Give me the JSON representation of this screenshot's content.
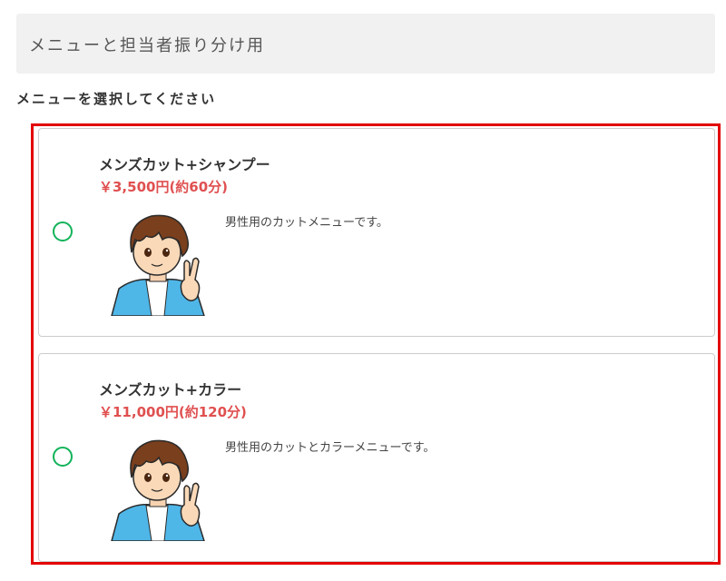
{
  "header": {
    "title": "メニューと担当者振り分け用"
  },
  "section": {
    "label": "メニューを選択してください"
  },
  "menus": [
    {
      "name": "メンズカット+シャンプー",
      "price": "￥3,500円(約60分)",
      "description": "男性用のカットメニューです。",
      "selected": false
    },
    {
      "name": "メンズカット+カラー",
      "price": "￥11,000円(約120分)",
      "description": "男性用のカットとカラーメニューです。",
      "selected": false
    }
  ],
  "colors": {
    "accent_radio": "#12b35a",
    "price": "#e05050",
    "highlight_border": "#e30000"
  }
}
